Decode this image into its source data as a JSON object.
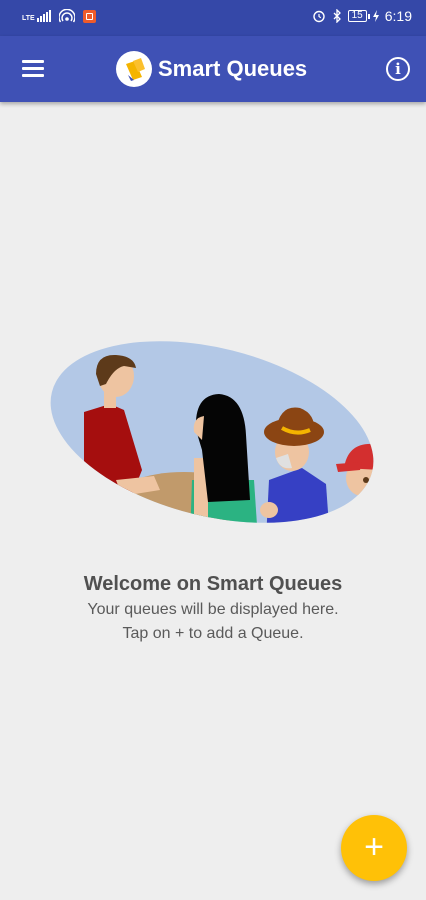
{
  "status_bar": {
    "network": "LTE",
    "battery": "15",
    "time": "6:19"
  },
  "app_bar": {
    "title": "Smart Queues",
    "menu_icon": "menu-icon",
    "info_icon": "info-icon",
    "color": "#3f51b5"
  },
  "empty_state": {
    "title": "Welcome on Smart Queues",
    "line1": "Your queues will be displayed here.",
    "line2": "Tap on + to add a Queue."
  },
  "fab": {
    "symbol": "+",
    "color": "#ffc107"
  }
}
